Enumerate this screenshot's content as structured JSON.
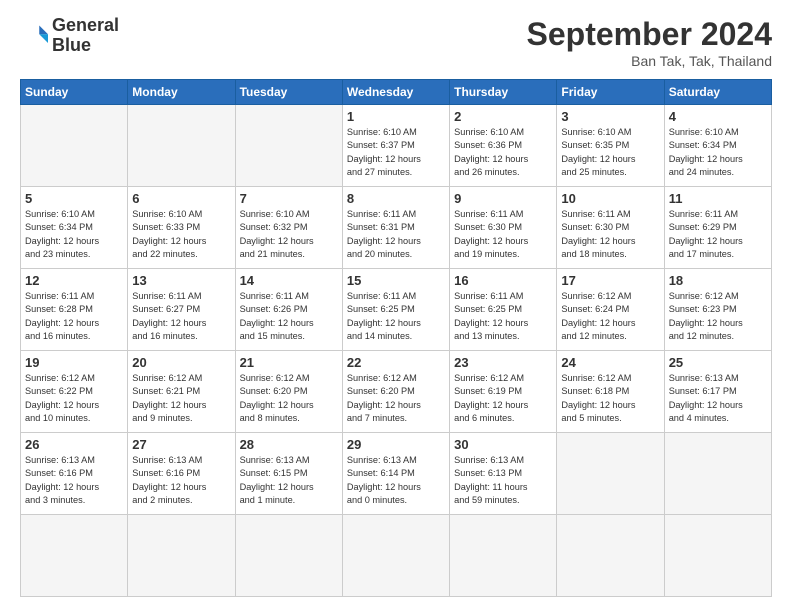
{
  "header": {
    "logo_line1": "General",
    "logo_line2": "Blue",
    "month": "September 2024",
    "location": "Ban Tak, Tak, Thailand"
  },
  "weekdays": [
    "Sunday",
    "Monday",
    "Tuesday",
    "Wednesday",
    "Thursday",
    "Friday",
    "Saturday"
  ],
  "days": [
    {
      "num": "",
      "info": ""
    },
    {
      "num": "",
      "info": ""
    },
    {
      "num": "",
      "info": ""
    },
    {
      "num": "1",
      "info": "Sunrise: 6:10 AM\nSunset: 6:37 PM\nDaylight: 12 hours\nand 27 minutes."
    },
    {
      "num": "2",
      "info": "Sunrise: 6:10 AM\nSunset: 6:36 PM\nDaylight: 12 hours\nand 26 minutes."
    },
    {
      "num": "3",
      "info": "Sunrise: 6:10 AM\nSunset: 6:35 PM\nDaylight: 12 hours\nand 25 minutes."
    },
    {
      "num": "4",
      "info": "Sunrise: 6:10 AM\nSunset: 6:34 PM\nDaylight: 12 hours\nand 24 minutes."
    },
    {
      "num": "5",
      "info": "Sunrise: 6:10 AM\nSunset: 6:34 PM\nDaylight: 12 hours\nand 23 minutes."
    },
    {
      "num": "6",
      "info": "Sunrise: 6:10 AM\nSunset: 6:33 PM\nDaylight: 12 hours\nand 22 minutes."
    },
    {
      "num": "7",
      "info": "Sunrise: 6:10 AM\nSunset: 6:32 PM\nDaylight: 12 hours\nand 21 minutes."
    },
    {
      "num": "8",
      "info": "Sunrise: 6:11 AM\nSunset: 6:31 PM\nDaylight: 12 hours\nand 20 minutes."
    },
    {
      "num": "9",
      "info": "Sunrise: 6:11 AM\nSunset: 6:30 PM\nDaylight: 12 hours\nand 19 minutes."
    },
    {
      "num": "10",
      "info": "Sunrise: 6:11 AM\nSunset: 6:30 PM\nDaylight: 12 hours\nand 18 minutes."
    },
    {
      "num": "11",
      "info": "Sunrise: 6:11 AM\nSunset: 6:29 PM\nDaylight: 12 hours\nand 17 minutes."
    },
    {
      "num": "12",
      "info": "Sunrise: 6:11 AM\nSunset: 6:28 PM\nDaylight: 12 hours\nand 16 minutes."
    },
    {
      "num": "13",
      "info": "Sunrise: 6:11 AM\nSunset: 6:27 PM\nDaylight: 12 hours\nand 16 minutes."
    },
    {
      "num": "14",
      "info": "Sunrise: 6:11 AM\nSunset: 6:26 PM\nDaylight: 12 hours\nand 15 minutes."
    },
    {
      "num": "15",
      "info": "Sunrise: 6:11 AM\nSunset: 6:25 PM\nDaylight: 12 hours\nand 14 minutes."
    },
    {
      "num": "16",
      "info": "Sunrise: 6:11 AM\nSunset: 6:25 PM\nDaylight: 12 hours\nand 13 minutes."
    },
    {
      "num": "17",
      "info": "Sunrise: 6:12 AM\nSunset: 6:24 PM\nDaylight: 12 hours\nand 12 minutes."
    },
    {
      "num": "18",
      "info": "Sunrise: 6:12 AM\nSunset: 6:23 PM\nDaylight: 12 hours\nand 12 minutes."
    },
    {
      "num": "19",
      "info": "Sunrise: 6:12 AM\nSunset: 6:22 PM\nDaylight: 12 hours\nand 10 minutes."
    },
    {
      "num": "20",
      "info": "Sunrise: 6:12 AM\nSunset: 6:21 PM\nDaylight: 12 hours\nand 9 minutes."
    },
    {
      "num": "21",
      "info": "Sunrise: 6:12 AM\nSunset: 6:20 PM\nDaylight: 12 hours\nand 8 minutes."
    },
    {
      "num": "22",
      "info": "Sunrise: 6:12 AM\nSunset: 6:20 PM\nDaylight: 12 hours\nand 7 minutes."
    },
    {
      "num": "23",
      "info": "Sunrise: 6:12 AM\nSunset: 6:19 PM\nDaylight: 12 hours\nand 6 minutes."
    },
    {
      "num": "24",
      "info": "Sunrise: 6:12 AM\nSunset: 6:18 PM\nDaylight: 12 hours\nand 5 minutes."
    },
    {
      "num": "25",
      "info": "Sunrise: 6:13 AM\nSunset: 6:17 PM\nDaylight: 12 hours\nand 4 minutes."
    },
    {
      "num": "26",
      "info": "Sunrise: 6:13 AM\nSunset: 6:16 PM\nDaylight: 12 hours\nand 3 minutes."
    },
    {
      "num": "27",
      "info": "Sunrise: 6:13 AM\nSunset: 6:16 PM\nDaylight: 12 hours\nand 2 minutes."
    },
    {
      "num": "28",
      "info": "Sunrise: 6:13 AM\nSunset: 6:15 PM\nDaylight: 12 hours\nand 1 minute."
    },
    {
      "num": "29",
      "info": "Sunrise: 6:13 AM\nSunset: 6:14 PM\nDaylight: 12 hours\nand 0 minutes."
    },
    {
      "num": "30",
      "info": "Sunrise: 6:13 AM\nSunset: 6:13 PM\nDaylight: 11 hours\nand 59 minutes."
    },
    {
      "num": "",
      "info": ""
    },
    {
      "num": "",
      "info": ""
    },
    {
      "num": "",
      "info": ""
    }
  ]
}
